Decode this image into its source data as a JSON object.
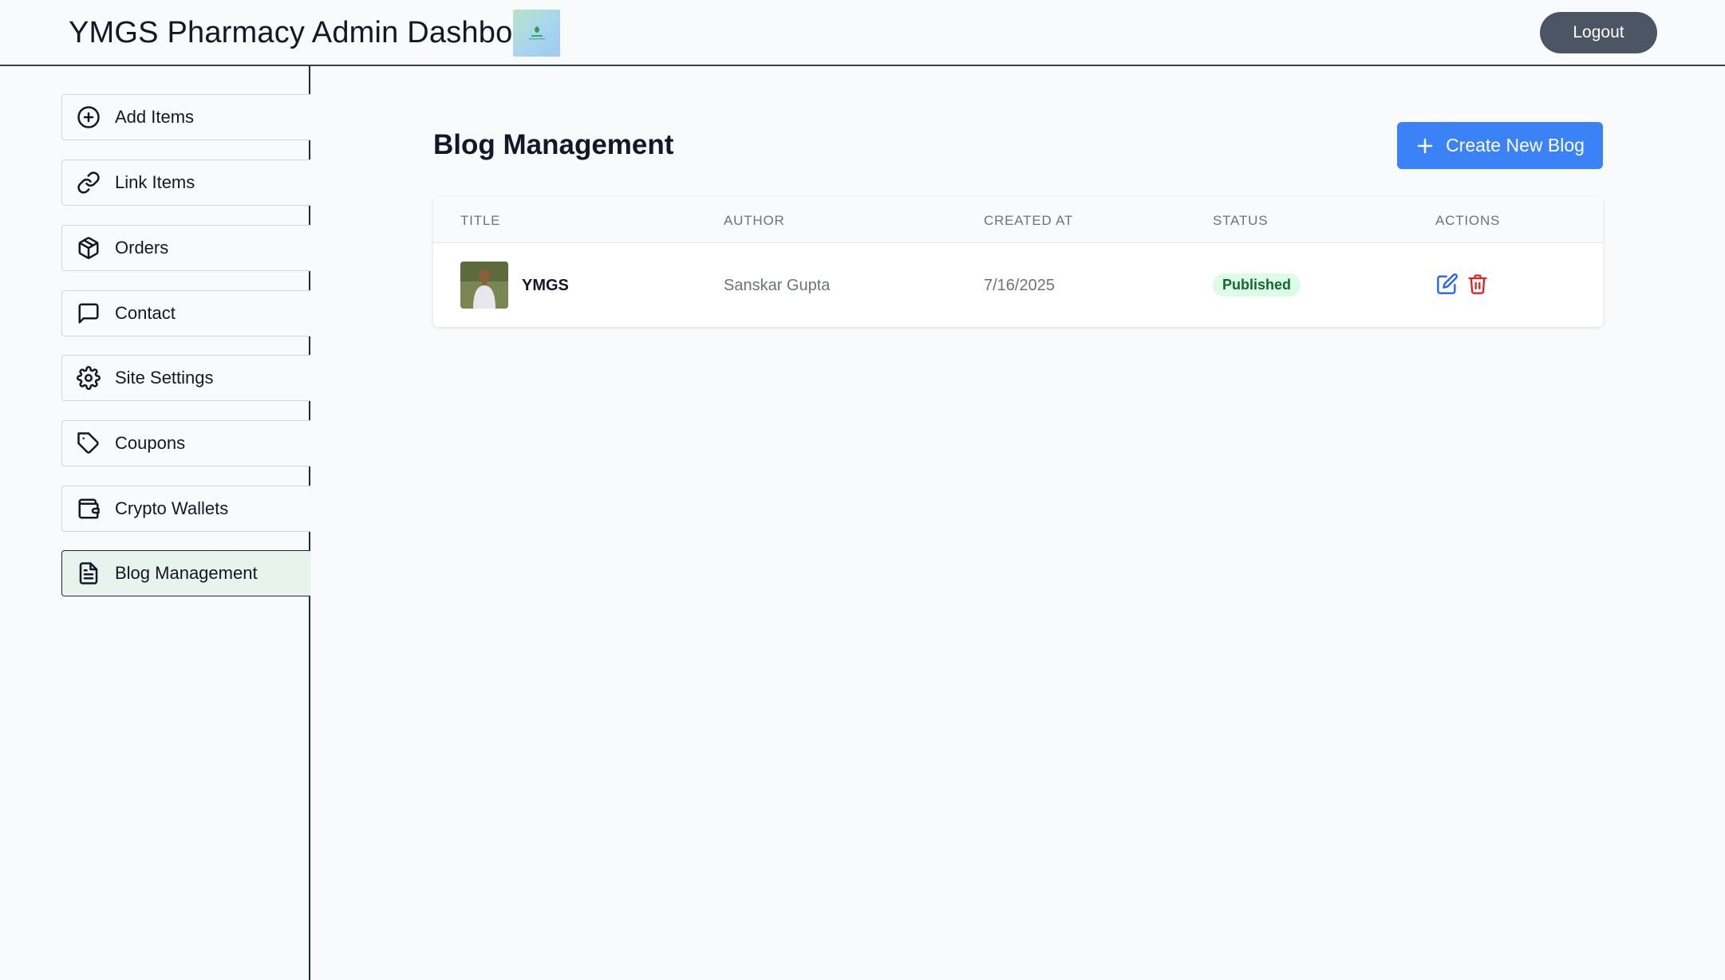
{
  "header": {
    "title": "YMGS Pharmacy Admin Dashboard",
    "logout_label": "Logout"
  },
  "sidebar": {
    "items": [
      {
        "label": "Add Items",
        "icon": "plus-circle-icon"
      },
      {
        "label": "Link Items",
        "icon": "link-icon"
      },
      {
        "label": "Orders",
        "icon": "package-icon"
      },
      {
        "label": "Contact",
        "icon": "message-square-icon"
      },
      {
        "label": "Site Settings",
        "icon": "gear-icon"
      },
      {
        "label": "Coupons",
        "icon": "tag-icon"
      },
      {
        "label": "Crypto Wallets",
        "icon": "wallet-icon"
      },
      {
        "label": "Blog Management",
        "icon": "file-text-icon",
        "active": true
      }
    ]
  },
  "main": {
    "title": "Blog Management",
    "create_label": "Create New Blog",
    "table": {
      "columns": [
        "TITLE",
        "AUTHOR",
        "CREATED AT",
        "STATUS",
        "ACTIONS"
      ],
      "rows": [
        {
          "title": "YMGS",
          "author": "Sanskar Gupta",
          "created_at": "7/16/2025",
          "status": "Published"
        }
      ]
    }
  },
  "colors": {
    "primary": "#3b82f6",
    "logout_bg": "#4b5563",
    "published_bg": "#dcfce7",
    "published_text": "#166534",
    "delete": "#dc2626",
    "edit": "#2563eb"
  }
}
